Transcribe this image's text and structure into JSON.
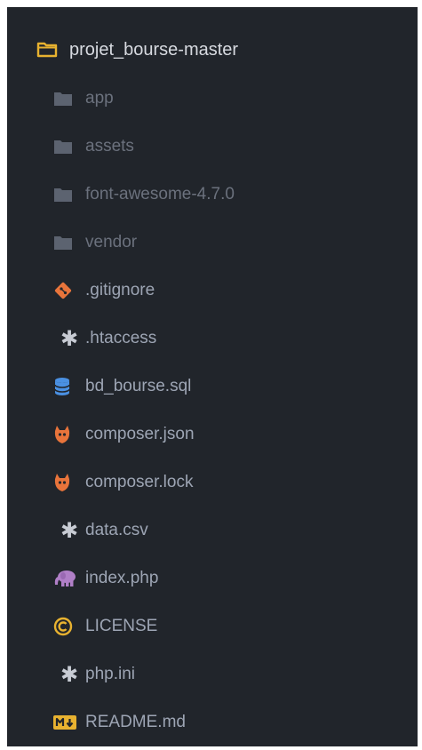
{
  "tree": {
    "root": {
      "label": "projet_bourse-master",
      "icon": "folder-open-outline-icon",
      "color": "#e8b230"
    },
    "items": [
      {
        "label": "app",
        "icon": "folder-icon",
        "kind": "folder"
      },
      {
        "label": "assets",
        "icon": "folder-icon",
        "kind": "folder"
      },
      {
        "label": "font-awesome-4.7.0",
        "icon": "folder-icon",
        "kind": "folder"
      },
      {
        "label": "vendor",
        "icon": "folder-icon",
        "kind": "folder"
      },
      {
        "label": ".gitignore",
        "icon": "git-icon",
        "kind": "file",
        "color": "#e8743b"
      },
      {
        "label": ".htaccess",
        "icon": "asterisk-icon",
        "kind": "file"
      },
      {
        "label": "bd_bourse.sql",
        "icon": "database-icon",
        "kind": "file",
        "color": "#4a90e2"
      },
      {
        "label": "composer.json",
        "icon": "composer-icon",
        "kind": "file",
        "color": "#e8743b"
      },
      {
        "label": "composer.lock",
        "icon": "composer-icon",
        "kind": "file",
        "color": "#e8743b"
      },
      {
        "label": "data.csv",
        "icon": "asterisk-icon",
        "kind": "file"
      },
      {
        "label": "index.php",
        "icon": "php-elephant-icon",
        "kind": "file",
        "color": "#b07fc7"
      },
      {
        "label": "LICENSE",
        "icon": "copyright-icon",
        "kind": "file",
        "color": "#e8b230"
      },
      {
        "label": "php.ini",
        "icon": "asterisk-icon",
        "kind": "file"
      },
      {
        "label": "README.md",
        "icon": "markdown-icon",
        "kind": "file",
        "color": "#e8b230"
      }
    ]
  }
}
